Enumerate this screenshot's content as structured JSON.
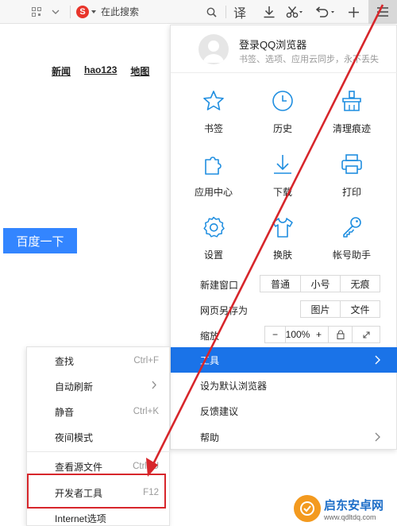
{
  "toolbar": {
    "search_engine_logo": "S",
    "search_placeholder": "在此搜索",
    "translate_label": "译",
    "icons": [
      "qr-icon",
      "chevron-down-icon",
      "search-icon",
      "download-icon",
      "scissors-icon",
      "undo-icon",
      "plus-icon",
      "menu-icon"
    ]
  },
  "page": {
    "links": [
      "新闻",
      "hao123",
      "地图"
    ],
    "baidu_button": "百度一下"
  },
  "menu": {
    "login_title": "登录QQ浏览器",
    "login_subtitle": "书签、选项、应用云同步，永不丢失",
    "grid": [
      {
        "label": "书签",
        "icon": "star-icon"
      },
      {
        "label": "历史",
        "icon": "clock-icon"
      },
      {
        "label": "清理痕迹",
        "icon": "broom-icon"
      },
      {
        "label": "应用中心",
        "icon": "puzzle-icon"
      },
      {
        "label": "下载",
        "icon": "download-icon"
      },
      {
        "label": "打印",
        "icon": "printer-icon"
      },
      {
        "label": "设置",
        "icon": "gear-icon"
      },
      {
        "label": "换肤",
        "icon": "tshirt-icon"
      },
      {
        "label": "帐号助手",
        "icon": "key-icon"
      }
    ],
    "new_window": {
      "label": "新建窗口",
      "options": [
        "普通",
        "小号",
        "无痕"
      ]
    },
    "save_page": {
      "label": "网页另存为",
      "options": [
        "图片",
        "文件"
      ]
    },
    "zoom": {
      "label": "缩放",
      "minus": "−",
      "value": "100%",
      "plus": "+"
    },
    "items": [
      {
        "label": "工具",
        "active": true,
        "has_submenu": true
      },
      {
        "label": "设为默认浏览器",
        "active": false,
        "has_submenu": false
      },
      {
        "label": "反馈建议",
        "active": false,
        "has_submenu": false
      },
      {
        "label": "帮助",
        "active": false,
        "has_submenu": true
      }
    ]
  },
  "submenu": {
    "items": [
      {
        "label": "查找",
        "shortcut": "Ctrl+F"
      },
      {
        "label": "自动刷新",
        "shortcut": ""
      },
      {
        "label": "静音",
        "shortcut": "Ctrl+K"
      },
      {
        "label": "夜间模式",
        "shortcut": ""
      },
      {
        "label": "查看源文件",
        "shortcut": "Ctrl+U"
      },
      {
        "label": "开发者工具",
        "shortcut": "F12"
      },
      {
        "label": "Internet选项",
        "shortcut": ""
      }
    ]
  },
  "watermark": {
    "title": "启东安卓网",
    "url": "www.qdltdq.com"
  },
  "colors": {
    "accent": "#1a73e8",
    "icon_blue": "#1f8ee0",
    "highlight_red": "#d7262b",
    "baidu_blue": "#3385ff"
  }
}
